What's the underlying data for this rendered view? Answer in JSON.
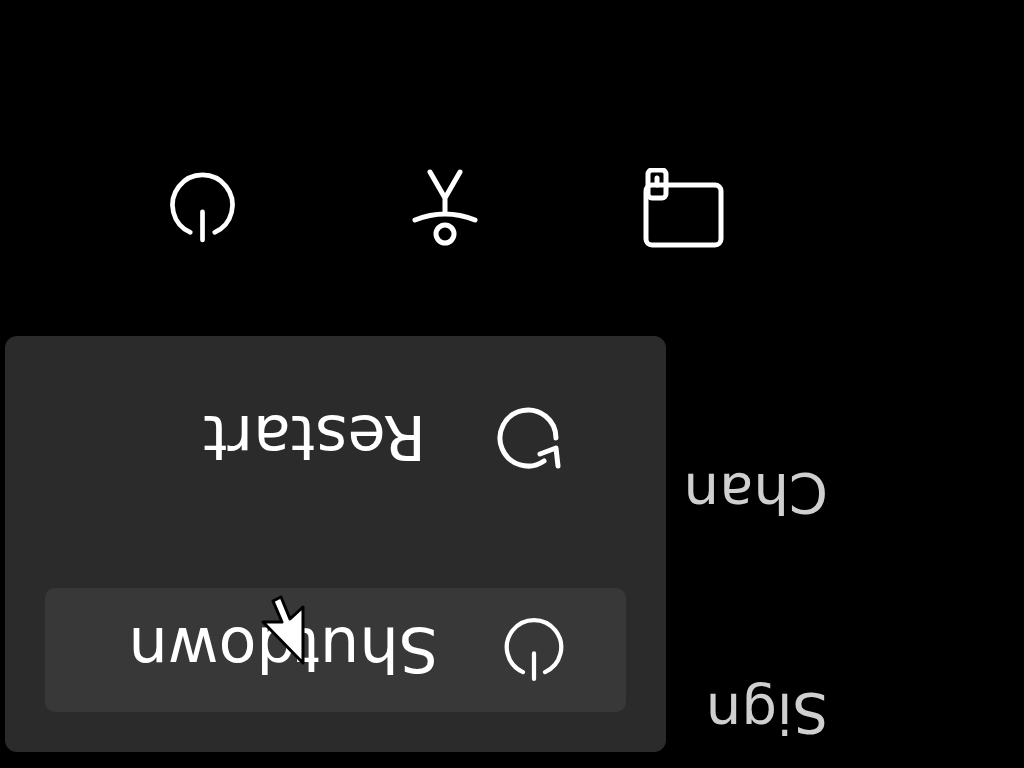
{
  "background_texts": [
    {
      "text": "Sign"
    },
    {
      "text": "Chan"
    }
  ],
  "power_menu": {
    "items": [
      {
        "label": "Shutdown",
        "kind": "shutdown",
        "selected": true
      },
      {
        "label": "Restart",
        "kind": "restart",
        "selected": false
      }
    ]
  }
}
